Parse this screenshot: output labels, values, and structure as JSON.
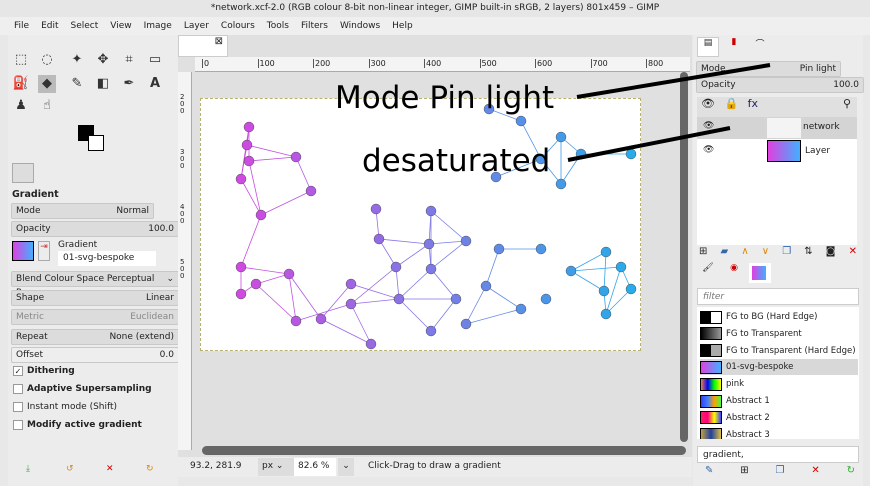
{
  "window": {
    "title": "*network.xcf-2.0 (RGB colour 8-bit non-linear integer, GIMP built-in sRGB, 2 layers) 801x459 – GIMP"
  },
  "menu": [
    "File",
    "Edit",
    "Select",
    "View",
    "Image",
    "Layer",
    "Colours",
    "Tools",
    "Filters",
    "Windows",
    "Help"
  ],
  "tool_options": {
    "title": "Gradient",
    "mode_label": "Mode",
    "mode_value": "Normal",
    "opacity_label": "Opacity",
    "opacity_value": "100.0",
    "gradient_label": "Gradient",
    "gradient_value": "01-svg-bespoke",
    "blend_space": "Blend Colour Space Perceptual R...",
    "shape_label": "Shape",
    "shape_value": "Linear",
    "metric_label": "Metric",
    "metric_value": "Euclidean",
    "repeat_label": "Repeat",
    "repeat_value": "None (extend)",
    "offset_label": "Offset",
    "offset_value": "0.0",
    "checks": [
      {
        "label": "Dithering",
        "checked": true
      },
      {
        "label": "Adaptive Supersampling",
        "checked": false
      },
      {
        "label": "Instant mode  (Shift)",
        "checked": false
      },
      {
        "label": "Modify active gradient",
        "checked": false
      }
    ]
  },
  "ruler": {
    "h": [
      "0",
      "100",
      "200",
      "300",
      "400",
      "500",
      "600",
      "700",
      "800"
    ],
    "v": [
      "2\n0\n0",
      "3\n0\n0",
      "4\n0\n0",
      "5\n0\n0"
    ]
  },
  "status": {
    "coords": "93.2, 281.9",
    "unit": "px",
    "zoom": "82.6 %",
    "message": "Click-Drag to draw a gradient"
  },
  "layers": {
    "mode_label": "Mode",
    "mode_value": "Pin light",
    "opacity_label": "Opacity",
    "opacity_value": "100.0",
    "items": [
      {
        "name": "network"
      },
      {
        "name": "Layer"
      }
    ]
  },
  "gradients": {
    "filter_placeholder": "filter",
    "tag_value": "gradient,",
    "items": [
      {
        "name": "FG to BG (Hard Edge)",
        "bg": "linear-gradient(90deg,#000 50%,#fff 50%)"
      },
      {
        "name": "FG to Transparent",
        "bg": "linear-gradient(90deg,#000,#999)"
      },
      {
        "name": "FG to Transparent (Hard Edge)",
        "bg": "linear-gradient(90deg,#000 50%,#aaa 50%)"
      },
      {
        "name": "01-svg-bespoke",
        "bg": "linear-gradient(90deg,#e040e0,#40b0ff)",
        "selected": true
      },
      {
        "name": "pink",
        "bg": "linear-gradient(90deg,#f08040,#0000ff,#00ff00,#ffff00)"
      },
      {
        "name": "Abstract 1",
        "bg": "linear-gradient(90deg,#3040ff,#4080ff,#ffa000,#40ff40)"
      },
      {
        "name": "Abstract 2",
        "bg": "linear-gradient(90deg,#ff2060,#ff0080,#ffff00,#4040ff)"
      },
      {
        "name": "Abstract 3",
        "bg": "linear-gradient(90deg,#c0a040,#2040a0,#e0c040)"
      }
    ]
  },
  "annotations": {
    "mode": "Mode Pin light",
    "desat": "desaturated"
  }
}
